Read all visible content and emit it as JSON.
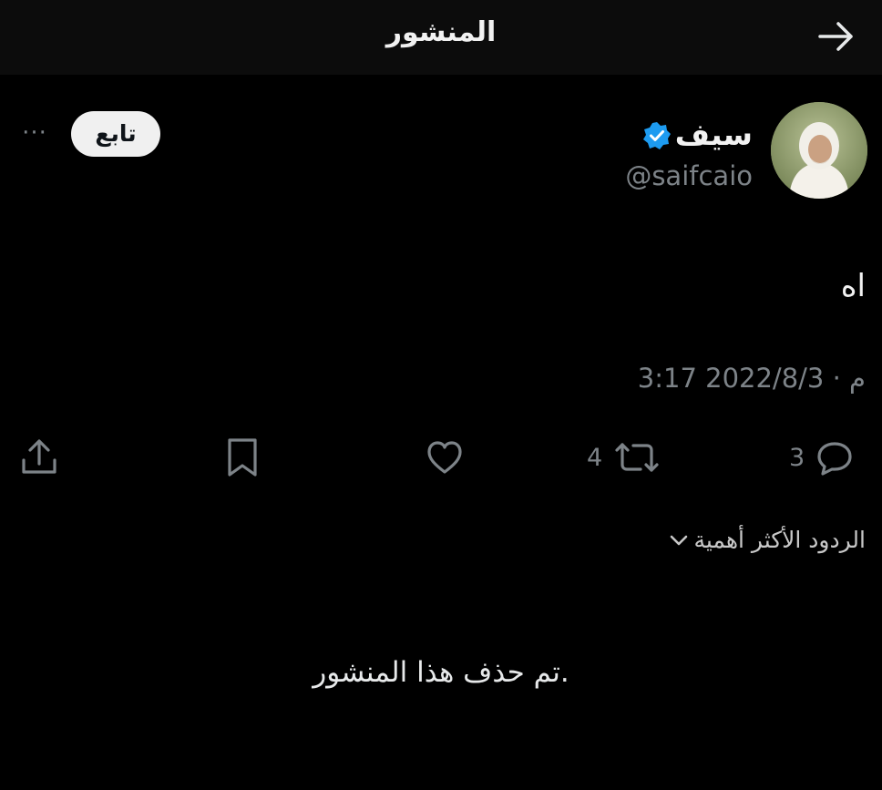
{
  "header": {
    "title": "المنشور",
    "back_icon": "arrow-right-icon"
  },
  "post": {
    "author_name": "سيف",
    "handle": "@saifcaio",
    "follow_label": "تابع",
    "more_label": "···",
    "text": "اه",
    "timestamp": "3:17 م · 2022/8/3",
    "verified_color": "#1d9bf0"
  },
  "actions": {
    "replies": "3",
    "retweets": "4",
    "icons": [
      "reply-icon",
      "retweet-icon",
      "like-icon",
      "bookmark-icon",
      "share-icon"
    ]
  },
  "replies_section": {
    "sort_label": "الردود الأكثر أهمية",
    "deleted_notice": "تم حذف هذا المنشور."
  },
  "colors": {
    "background": "#000000",
    "header": "#0c0c0c",
    "muted": "#7d8388"
  }
}
